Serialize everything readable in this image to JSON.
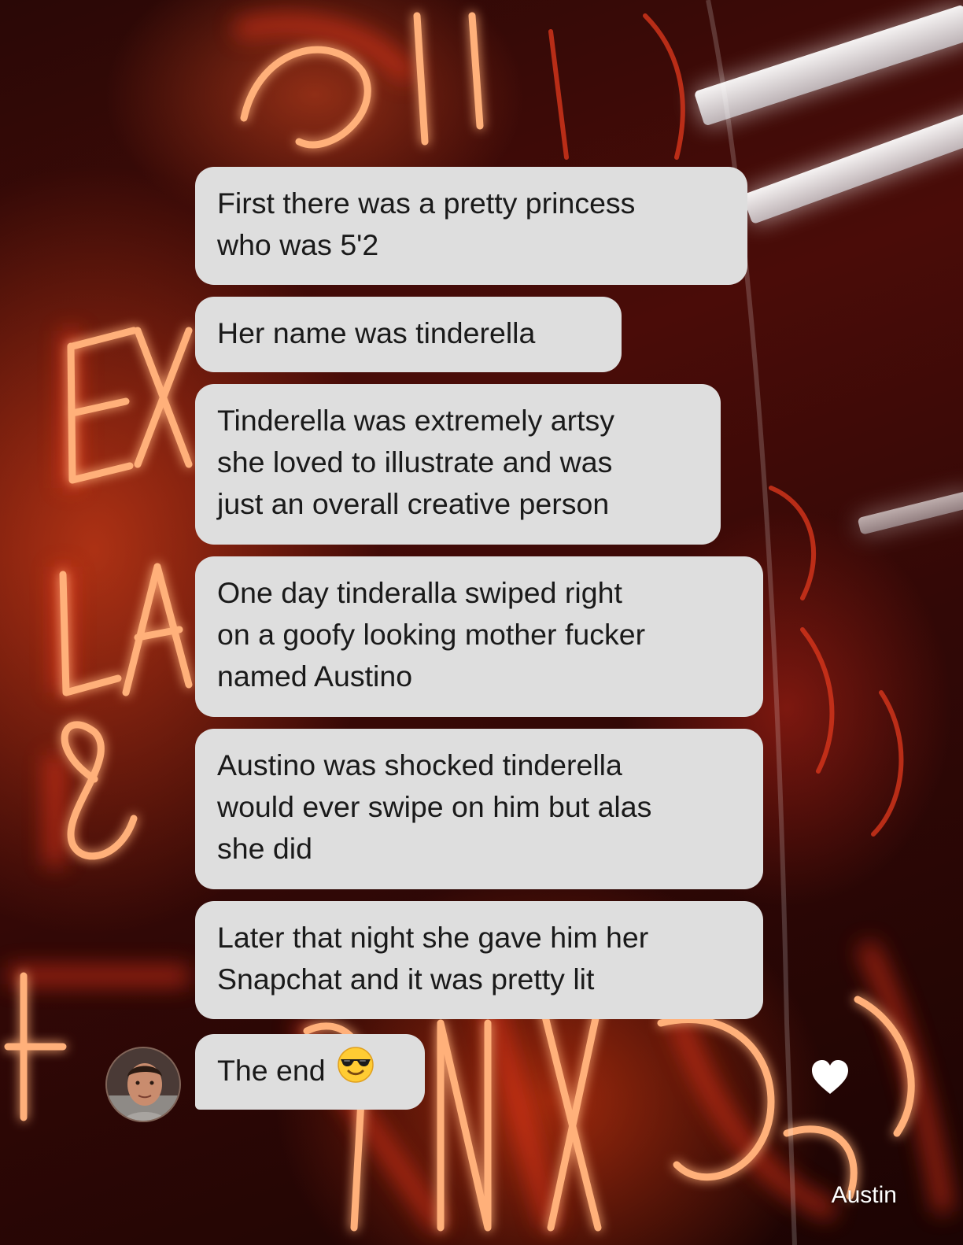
{
  "messages": [
    {
      "lines": [
        "First there was a pretty princess",
        "who was 5'2"
      ]
    },
    {
      "lines": [
        "Her name was tinderella"
      ]
    },
    {
      "lines": [
        "Tinderella was extremely artsy",
        "she loved to illustrate and was",
        "just an overall creative person"
      ]
    },
    {
      "lines": [
        "One day tinderalla swiped right",
        "on a goofy looking mother fucker",
        "named Austino"
      ]
    },
    {
      "lines": [
        "Austino was shocked tinderella",
        "would ever swipe on him but alas",
        "she did"
      ]
    },
    {
      "lines": [
        "Later that night she gave him her",
        "Snapchat and it was pretty lit"
      ]
    },
    {
      "lines": [
        "The end"
      ],
      "emoji": "sunglasses-face-emoji"
    }
  ],
  "sender_name": "Austin",
  "icons": {
    "avatar": "profile-photo",
    "like": "heart-icon"
  },
  "colors": {
    "bubble": "#dedede",
    "bubble_text": "#1a1a1a",
    "heart": "#ffffff"
  }
}
